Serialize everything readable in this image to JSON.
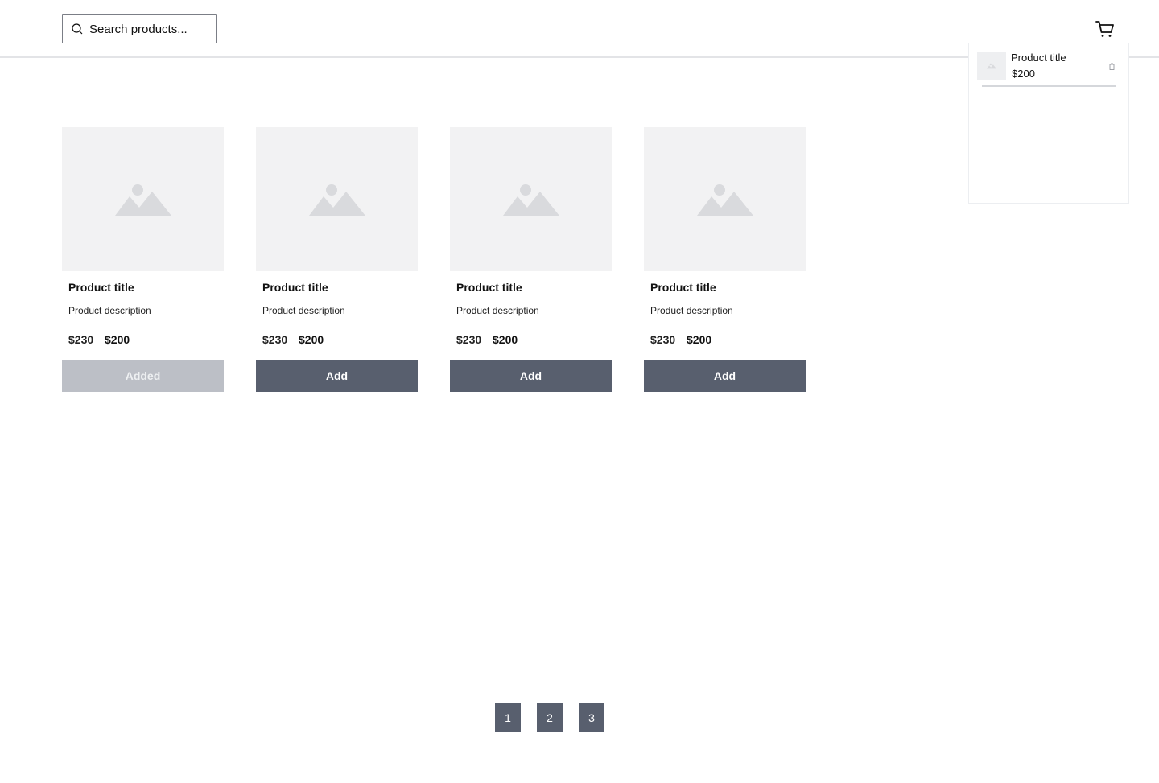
{
  "search": {
    "placeholder": "Search products..."
  },
  "cart": {
    "icon": "cart-icon",
    "items": [
      {
        "title": "Product title",
        "price": "$200"
      }
    ]
  },
  "products": [
    {
      "title": "Product title",
      "description": "Product description",
      "old_price": "$230",
      "price": "$200",
      "button": "Added",
      "added": true
    },
    {
      "title": "Product title",
      "description": "Product description",
      "old_price": "$230",
      "price": "$200",
      "button": "Add",
      "added": false
    },
    {
      "title": "Product title",
      "description": "Product description",
      "old_price": "$230",
      "price": "$200",
      "button": "Add",
      "added": false
    },
    {
      "title": "Product title",
      "description": "Product description",
      "old_price": "$230",
      "price": "$200",
      "button": "Add",
      "added": false
    }
  ],
  "pagination": [
    "1",
    "2",
    "3"
  ],
  "colors": {
    "button": "#585f6e",
    "button_disabled": "#bcbfc6",
    "image_bg": "#f2f2f3"
  }
}
